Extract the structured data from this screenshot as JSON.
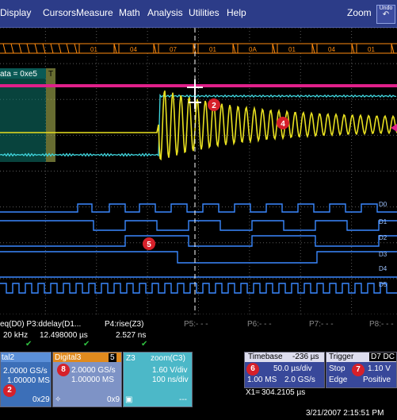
{
  "menu": {
    "items": [
      "Display",
      "Cursors",
      "Measure",
      "Math",
      "Analysis",
      "Utilities",
      "Help"
    ],
    "zoom_label": "Zoom",
    "undo_label": "Undo"
  },
  "bus": {
    "values": [
      "01",
      "04",
      "07",
      "01",
      "0A",
      "01",
      "04",
      "01"
    ]
  },
  "trigger_label": "ata = 0xe5",
  "t_marker": "T",
  "digital_labels": [
    "D0",
    "D1",
    "D2",
    "D3",
    "D4",
    "D5"
  ],
  "markers": {
    "m2": "2",
    "m4": "4",
    "m5": "5"
  },
  "measurements": {
    "row1_left": "eq(D0) P3:ddelay(D1...",
    "row1_p4": "P4:rise(Z3)",
    "row2_val1": "20 kHz",
    "row2_val2": "12.498000 µs",
    "row2_val3": "2.527 ns",
    "p_labels": [
      "P5:- - -",
      "P6:- - -",
      "P7:- - -",
      "P8:- - -"
    ]
  },
  "tiles": {
    "digital2": {
      "title": "tal2",
      "l1": "2.0000 GS/s",
      "l2": "1.00000 MS",
      "foot": "0x29",
      "badge": "2"
    },
    "digital3": {
      "title": "Digital3",
      "tag": "5",
      "l1": "2.0000 GS/s",
      "l2": "1.00000 MS",
      "foot": "0x9",
      "badge": "8"
    },
    "zoom": {
      "title": "Z3",
      "title2": "zoom(C3)",
      "l1": "1.60 V/div",
      "l2": "100 ns/div",
      "foot": "---"
    },
    "timebase": {
      "title": "Timebase",
      "offset": "-236 µs",
      "l1": "50.0 µs/div",
      "l2a": "1.00 MS",
      "l2b": "2.0 GS/s",
      "x1": "X1=",
      "x1val": "304.2105 µs",
      "badge": "6"
    },
    "trigger": {
      "title": "Trigger",
      "tag": "D7 DC",
      "l1a": "Stop",
      "l1b": "1.10 V",
      "l2a": "Edge",
      "l2b": "Positive",
      "badge": "7"
    }
  },
  "status": {
    "datetime": "3/21/2007 2:15:51 PM"
  },
  "colors": {
    "menubar": "#2c3c88",
    "grid": "#5a5a5a",
    "digital": "#3a88ff",
    "analog": "#e8e020",
    "pink": "#e0208a",
    "cyan": "#40d8e0",
    "bus": "#ff8c10",
    "green": "#30c040",
    "badge": "#d6202a"
  }
}
